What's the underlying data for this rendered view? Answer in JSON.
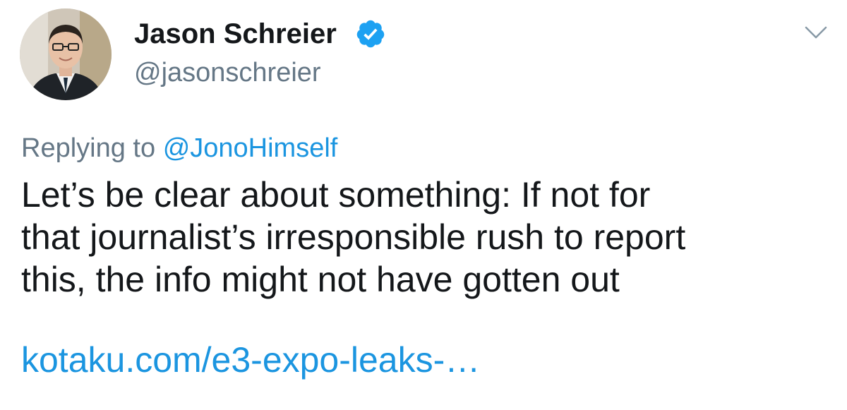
{
  "author": {
    "display_name": "Jason Schreier",
    "handle": "@jasonschreier",
    "verified": true,
    "avatar_icon": "profile-photo"
  },
  "reply": {
    "prefix": "Replying to",
    "mention": "@JonoHimself"
  },
  "tweet": {
    "lines": [
      "Let’s be clear about something: If not for",
      "that journalist’s irresponsible rush to report",
      "this, the info might not have gotten out"
    ],
    "link": "kotaku.com/e3-expo-leaks-…"
  },
  "icons": {
    "verified": "verified-badge-icon",
    "menu": "chevron-down-icon"
  },
  "colors": {
    "text": "#14171a",
    "secondary": "#657786",
    "link": "#1b95e0",
    "verified": "#1da1f2"
  }
}
